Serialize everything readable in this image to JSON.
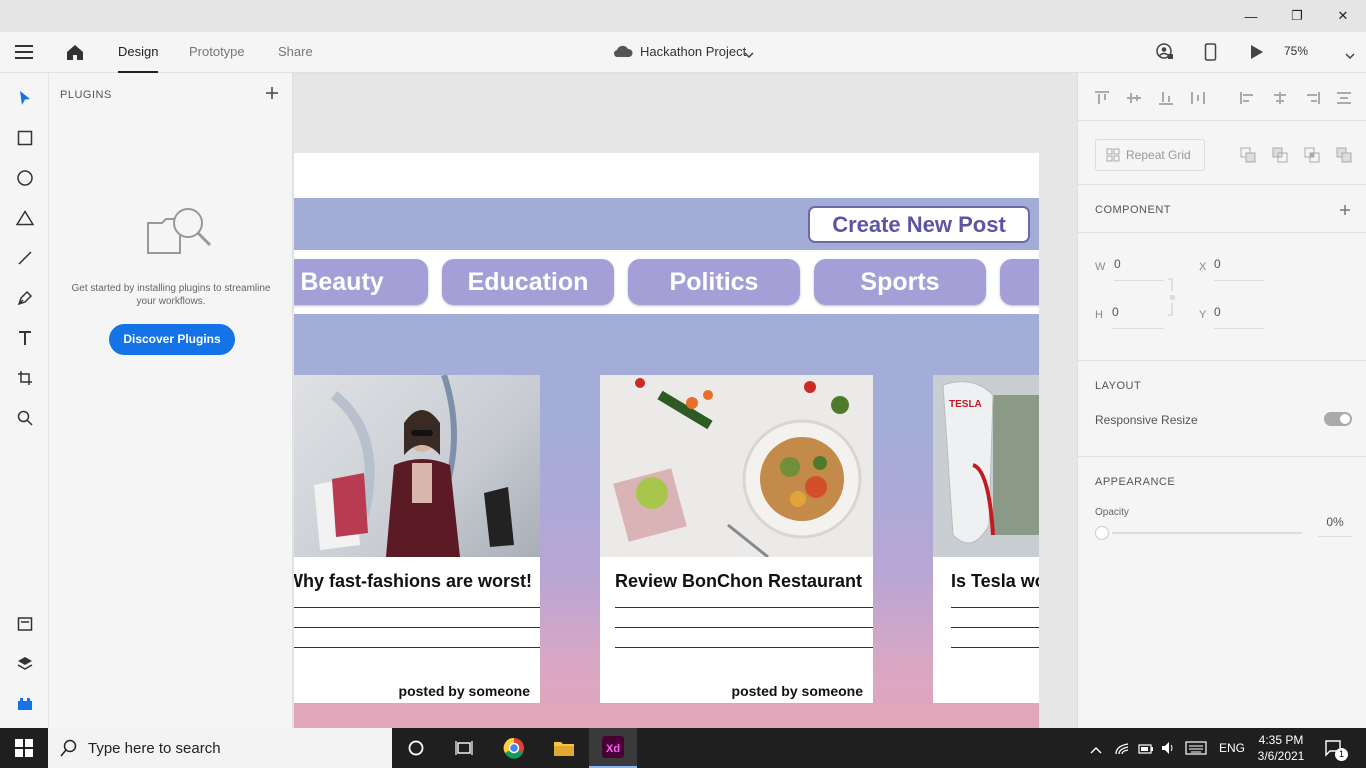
{
  "window": {
    "minimize": "—",
    "restore": "❐",
    "close": "✕"
  },
  "menubar": {
    "tabs": [
      {
        "label": "Design"
      },
      {
        "label": "Prototype"
      },
      {
        "label": "Share"
      }
    ],
    "document_title": "Hackathon Project",
    "zoom": "75%"
  },
  "plugins": {
    "header": "PLUGINS",
    "empty_text": "Get started by installing plugins to streamline your workflows.",
    "discover_label": "Discover Plugins"
  },
  "artboard": {
    "create_label": "Create New Post",
    "categories": [
      "Beauty",
      "Education",
      "Politics",
      "Sports"
    ],
    "cards": [
      {
        "title": "Why fast-fashions are worst!",
        "author": "posted by someone"
      },
      {
        "title": "Review BonChon Restaurant",
        "author": "posted by someone"
      },
      {
        "title": "Is Tesla wo",
        "author": ""
      }
    ],
    "tesla_sign": "TESLA"
  },
  "properties": {
    "repeat_grid": "Repeat Grid",
    "component_header": "COMPONENT",
    "w_label": "W",
    "w_value": "0",
    "x_label": "X",
    "x_value": "0",
    "h_label": "H",
    "h_value": "0",
    "y_label": "Y",
    "y_value": "0",
    "layout_header": "LAYOUT",
    "responsive_resize": "Responsive Resize",
    "responsive_on": true,
    "appearance_header": "APPEARANCE",
    "opacity_label": "Opacity",
    "opacity_value": "0%"
  },
  "taskbar": {
    "search_placeholder": "Type here to search",
    "language": "ENG",
    "time": "4:35 PM",
    "date": "3/6/2021",
    "notifications": "1"
  },
  "colors": {
    "accent_blue": "#1473e6",
    "chip": "#a59fd8",
    "hero": "#a3acd7",
    "create_text": "#5b55a4"
  }
}
